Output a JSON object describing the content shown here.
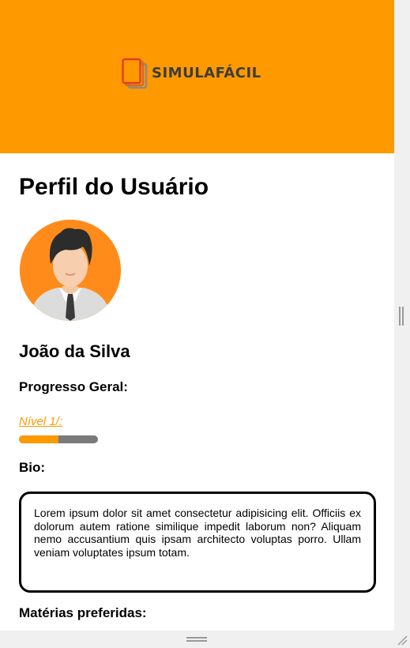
{
  "header": {
    "brand_name": "SIMULAFÁCIL",
    "background_color": "#ff9900"
  },
  "page": {
    "title": "Perfil do Usuário"
  },
  "profile": {
    "avatar_icon": "user-avatar-icon",
    "name": "João da Silva"
  },
  "progress": {
    "heading": "Progresso Geral:",
    "level_label": "Nível 1/:",
    "fraction": 0.5,
    "fill_color": "#ff9900",
    "track_color": "#7a7a7a"
  },
  "bio": {
    "heading": "Bio:",
    "text": "Lorem ipsum dolor sit amet consectetur adipisicing elit. Officiis ex dolorum autem ratione similique impedit laborum non? Aliquam nemo accusantium quis ipsam architecto voluptas porro. Ullam veniam voluptates ipsum totam."
  },
  "favorites": {
    "heading": "Matérias preferidas:"
  }
}
